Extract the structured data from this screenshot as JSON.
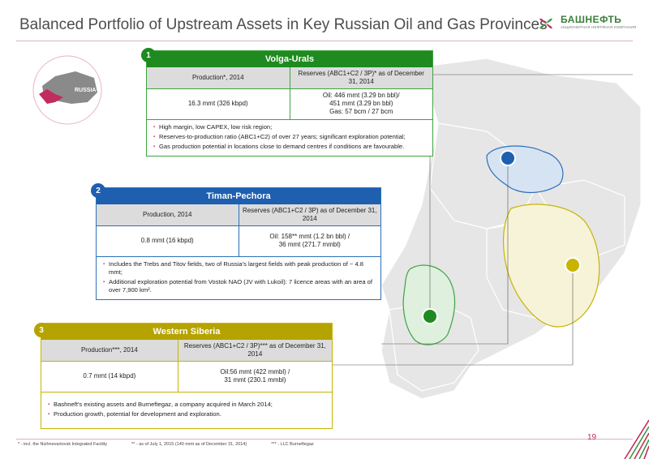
{
  "page": {
    "title": "Balanced Portfolio of Upstream Assets in Key Russian Oil and Gas Provinces",
    "page_number": "19"
  },
  "logo": {
    "name": "БАШНЕФТЬ",
    "tagline": "АКЦИОНЕРНАЯ НЕФТЯНАЯ КОМПАНИЯ"
  },
  "globe": {
    "label": "RUSSIA"
  },
  "regions": [
    {
      "number": "1",
      "name": "Volga-Urals",
      "production_header": "Production*, 2014",
      "reserves_header": "Reserves (ABC1+C2 / 3P)* as of December 31, 2014",
      "production_value": "16.3 mmt (326 kbpd)",
      "reserves_value_lines": [
        "Oil: 446 mmt (3.29 bn bbl)/",
        "451 mmt (3.29 bn bbl)",
        "Gas: 57 bcm / 27 bcm"
      ],
      "bullets": [
        "High margin, low CAPEX, low risk region;",
        "Reserves-to-production ratio (ABC1+C2) of over 27 years; significant exploration potential;",
        "Gas production potential in locations close to demand centres if conditions are favourable."
      ],
      "color": "#1f8a1f"
    },
    {
      "number": "2",
      "name": "Timan-Pechora",
      "production_header": "Production, 2014",
      "reserves_header": "Reserves (ABC1+C2 / 3P) as of December 31, 2014",
      "production_value": "0.8 mmt (16 kbpd)",
      "reserves_value_lines": [
        "Oil: 158** mmt (1.2 bn bbl) /",
        "36 mmt (271.7 mmbl)"
      ],
      "bullets": [
        "Includes the Trebs and Titov fields, two of Russia's largest fields with peak production of ~ 4.8 mmt;",
        "Additional exploration potential from Vostok NAO (JV with Lukoil): 7 licence areas with an area of over 7,900 km²."
      ],
      "color": "#1f5fb0"
    },
    {
      "number": "3",
      "name": "Western Siberia",
      "production_header": "Production***, 2014",
      "reserves_header": "Reserves (ABC1+C2 / 3P)*** as of December 31, 2014",
      "production_value": "0.7 mmt (14 kbpd)",
      "reserves_value_lines": [
        "Oil:56 mmt (422 mmbl) /",
        "31 mmt (230.1 mmbl)"
      ],
      "bullets": [
        "Bashneft's existing assets and Burneftegaz, a company acquired in March 2014;",
        "Production growth, potential for development and exploration."
      ],
      "color": "#b5a300"
    }
  ],
  "footnotes": [
    "* - incl. the Nizhnevartovsk Integrated Facility",
    "** - as of July 1, 2015 (140 mmt as of December 31, 2014)",
    "*** - LLC Burneftegaz"
  ],
  "colors": {
    "accent": "#c22b5d",
    "volga": "#1f8a1f",
    "timan": "#1f5fb0",
    "siberia": "#b5a300"
  }
}
